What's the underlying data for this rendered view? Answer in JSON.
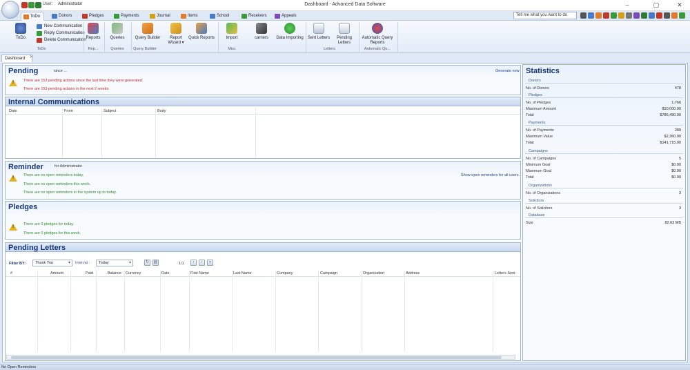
{
  "window": {
    "title": "Dashboard - Advanced Data Software",
    "user_label": "User:",
    "user_value": "Administrator",
    "controls": {
      "minimize": "–",
      "maximize": "▢",
      "close": "✕"
    }
  },
  "tabs": [
    {
      "label": "ToDo",
      "color": "#e07b2a"
    },
    {
      "label": "Donors",
      "color": "#4a7bc8"
    },
    {
      "label": "Pledges",
      "color": "#c0392b"
    },
    {
      "label": "Payments",
      "color": "#3a9a3a"
    },
    {
      "label": "Journal",
      "color": "#d4a017"
    },
    {
      "label": "Items",
      "color": "#e07b2a"
    },
    {
      "label": "School",
      "color": "#4a7bc8"
    },
    {
      "label": "Receivers",
      "color": "#3a9a3a"
    },
    {
      "label": "Appeals",
      "color": "#7a4ab8"
    }
  ],
  "tell_me": {
    "placeholder": "Tell me what you want to do"
  },
  "ribbon": {
    "todo": "ToDo",
    "new_communication": "New Communication",
    "reply_communication": "Reply Communication",
    "delete_communication": "Delete Communication",
    "reports": "Reports",
    "queries": "Queries",
    "query_builder": "Query Builder",
    "report_wizard": "Report Wizard ▾",
    "quick_reports": "Quick Reports",
    "import": "Import",
    "carriers": "carriers",
    "data_importing": "Data Importing",
    "sent_letters": "Sent Letters",
    "pending_letters": "Pending Letters",
    "automatic_query_reports": "Automatic Query Reports",
    "groups": {
      "todo": "ToDo",
      "reports": "Rep...",
      "queries": "Queries",
      "query_builder": "Query Builder",
      "misc": "Misc",
      "letters": "Letters",
      "automatic": "Automatic Qu..."
    }
  },
  "doc_tab": "Dashboard",
  "pending": {
    "title": "Pending",
    "since": "since ...",
    "line1": "There are 153 pending actions since the last time they were generated.",
    "line2": "There are 153 pending actions in the next 2 weeks.",
    "generate_now": "Generate now"
  },
  "internal_comms": {
    "title": "Internal Communications",
    "columns": [
      "Date",
      "From",
      "Subject",
      "Body"
    ]
  },
  "reminder": {
    "title": "Reminder",
    "for_user": "for Administrator",
    "line1": "There are no open reminders today.",
    "line2": "There are no open reminders this week.",
    "line3": "There are no open reminders in the system up to today.",
    "show_all": "Show open reminders for all users."
  },
  "pledges": {
    "title": "Pledges",
    "line1": "There are 0 pledges for today.",
    "line2": "There are 0 pledges for this week."
  },
  "pending_letters": {
    "title": "Pending Letters",
    "filter_label": "Filter BY:",
    "filter_value": "Thank You",
    "interval_label": "Interval :",
    "interval_value": "Today",
    "page": "1/1",
    "columns": [
      "#",
      "Amount",
      "Paid",
      "Balance",
      "Currency",
      "Date",
      "First Name",
      "Last Name",
      "Company",
      "Campaign",
      "Organization",
      "Address",
      "Letters Sent"
    ]
  },
  "statistics": {
    "title": "Statistics",
    "donors_header": "Donors",
    "donors_count_label": "No. of Donors",
    "donors_count": "478",
    "pledges_header": "Pledges",
    "pledges_count_label": "No. of Pledges",
    "pledges_count": "1,766",
    "pledges_max_label": "Maximum Amount",
    "pledges_max": "$10,000.00",
    "pledges_total_label": "Total",
    "pledges_total": "$786,490.00",
    "payments_header": "Payments",
    "payments_count_label": "No. of Payments",
    "payments_count": "289",
    "payments_max_label": "Maximum Value",
    "payments_max": "$2,360.00",
    "payments_total_label": "Total",
    "payments_total": "$141,715.00",
    "campaigns_header": "Campaigns",
    "campaigns_count_label": "No. of Campaigns",
    "campaigns_count": "5",
    "campaigns_min_label": "Minimum Goal",
    "campaigns_min": "$0.00",
    "campaigns_max_label": "Maximum Goal",
    "campaigns_max": "$0.00",
    "campaigns_total_label": "Total",
    "campaigns_total": "$0.00",
    "organizations_header": "Organizations",
    "organizations_count_label": "No. of Organizations",
    "organizations_count": "3",
    "solicitors_header": "Solicitors",
    "solicitors_count_label": "No. of Solicitors",
    "solicitors_count": "3",
    "database_header": "Database",
    "database_size_label": "Size",
    "database_size": "82.63 MB"
  },
  "status_bar": "No Open Reminders"
}
